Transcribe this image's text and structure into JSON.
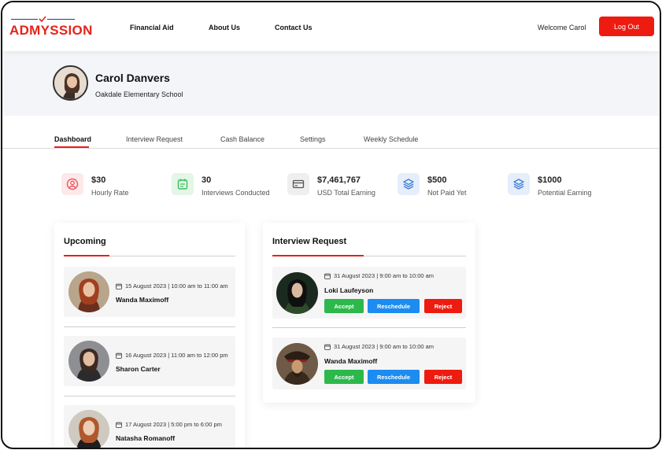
{
  "brand": {
    "name": "ADMYSSION",
    "accent": "#e4241a",
    "navy": "#2b3a7a"
  },
  "nav": [
    {
      "label": "Financial Aid"
    },
    {
      "label": "About Us"
    },
    {
      "label": "Contact Us"
    }
  ],
  "header": {
    "welcome": "Welcome Carol",
    "logout_label": "Log Out"
  },
  "profile": {
    "name": "Carol Danvers",
    "school": "Oakdale Elementary School"
  },
  "tabs": [
    {
      "label": "Dashboard",
      "active": true
    },
    {
      "label": "Interview Request"
    },
    {
      "label": "Cash Balance"
    },
    {
      "label": "Settings"
    },
    {
      "label": "Weekly Schedule"
    }
  ],
  "stats": [
    {
      "value": "$30",
      "label": "Hourly Rate",
      "icon": "user-circle-icon",
      "color": "#f0565d",
      "bg": "#fde9ea"
    },
    {
      "value": "30",
      "label": "Interviews Conducted",
      "icon": "calendar-icon",
      "color": "#3cbf5c",
      "bg": "#e3f6e7"
    },
    {
      "value": "$7,461,767",
      "label": "USD Total Earning",
      "icon": "credit-card-icon",
      "color": "#555555",
      "bg": "#efefef"
    },
    {
      "value": "$500",
      "label": "Not Paid Yet",
      "icon": "layers-icon",
      "color": "#3a7bd5",
      "bg": "#e6edfb"
    },
    {
      "value": "$1000",
      "label": "Potential Earning",
      "icon": "layers-icon",
      "color": "#3a7bd5",
      "bg": "#e6edfb"
    }
  ],
  "upcoming": {
    "title": "Upcoming",
    "items": [
      {
        "date": "15 August 2023 | 10:00 am to 11:00 am",
        "name": "Wanda Maximoff"
      },
      {
        "date": "16 August 2023 | 11:00 am to 12:00 pm",
        "name": "Sharon Carter"
      },
      {
        "date": "17 August 2023 | 5:00 pm to 6:00 pm",
        "name": "Natasha Romanoff"
      }
    ]
  },
  "requests": {
    "title": "Interview Request",
    "accept_label": "Accept",
    "reschedule_label": "Reschedule",
    "reject_label": "Reject",
    "items": [
      {
        "date": "31 August 2023 | 9:00 am to 10:00 am",
        "name": "Loki Laufeyson"
      },
      {
        "date": "31 August 2023 | 9:00 am to 10:00 am",
        "name": "Wanda Maximoff"
      }
    ]
  }
}
